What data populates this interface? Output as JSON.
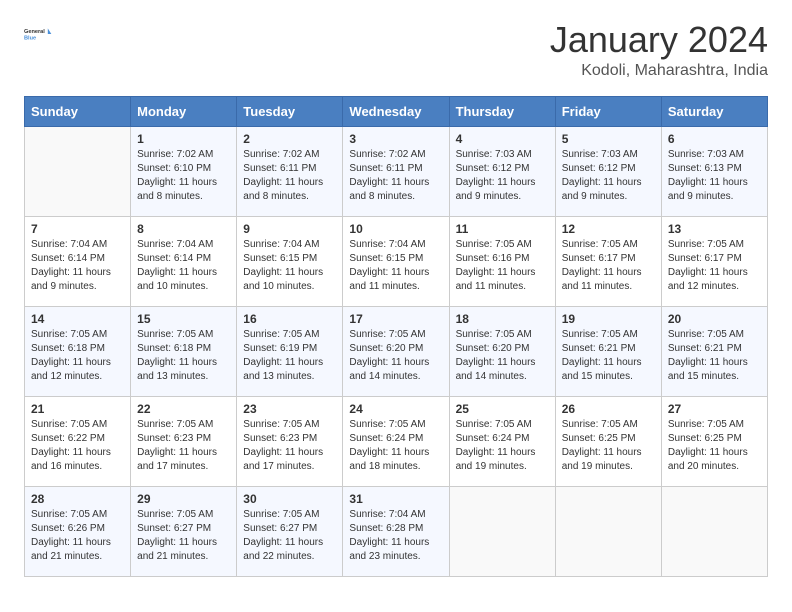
{
  "header": {
    "logo_line1": "General",
    "logo_line2": "Blue",
    "month": "January 2024",
    "location": "Kodoli, Maharashtra, India"
  },
  "weekdays": [
    "Sunday",
    "Monday",
    "Tuesday",
    "Wednesday",
    "Thursday",
    "Friday",
    "Saturday"
  ],
  "weeks": [
    [
      {
        "day": "",
        "info": ""
      },
      {
        "day": "1",
        "info": "Sunrise: 7:02 AM\nSunset: 6:10 PM\nDaylight: 11 hours\nand 8 minutes."
      },
      {
        "day": "2",
        "info": "Sunrise: 7:02 AM\nSunset: 6:11 PM\nDaylight: 11 hours\nand 8 minutes."
      },
      {
        "day": "3",
        "info": "Sunrise: 7:02 AM\nSunset: 6:11 PM\nDaylight: 11 hours\nand 8 minutes."
      },
      {
        "day": "4",
        "info": "Sunrise: 7:03 AM\nSunset: 6:12 PM\nDaylight: 11 hours\nand 9 minutes."
      },
      {
        "day": "5",
        "info": "Sunrise: 7:03 AM\nSunset: 6:12 PM\nDaylight: 11 hours\nand 9 minutes."
      },
      {
        "day": "6",
        "info": "Sunrise: 7:03 AM\nSunset: 6:13 PM\nDaylight: 11 hours\nand 9 minutes."
      }
    ],
    [
      {
        "day": "7",
        "info": "Sunrise: 7:04 AM\nSunset: 6:14 PM\nDaylight: 11 hours\nand 9 minutes."
      },
      {
        "day": "8",
        "info": "Sunrise: 7:04 AM\nSunset: 6:14 PM\nDaylight: 11 hours\nand 10 minutes."
      },
      {
        "day": "9",
        "info": "Sunrise: 7:04 AM\nSunset: 6:15 PM\nDaylight: 11 hours\nand 10 minutes."
      },
      {
        "day": "10",
        "info": "Sunrise: 7:04 AM\nSunset: 6:15 PM\nDaylight: 11 hours\nand 11 minutes."
      },
      {
        "day": "11",
        "info": "Sunrise: 7:05 AM\nSunset: 6:16 PM\nDaylight: 11 hours\nand 11 minutes."
      },
      {
        "day": "12",
        "info": "Sunrise: 7:05 AM\nSunset: 6:17 PM\nDaylight: 11 hours\nand 11 minutes."
      },
      {
        "day": "13",
        "info": "Sunrise: 7:05 AM\nSunset: 6:17 PM\nDaylight: 11 hours\nand 12 minutes."
      }
    ],
    [
      {
        "day": "14",
        "info": "Sunrise: 7:05 AM\nSunset: 6:18 PM\nDaylight: 11 hours\nand 12 minutes."
      },
      {
        "day": "15",
        "info": "Sunrise: 7:05 AM\nSunset: 6:18 PM\nDaylight: 11 hours\nand 13 minutes."
      },
      {
        "day": "16",
        "info": "Sunrise: 7:05 AM\nSunset: 6:19 PM\nDaylight: 11 hours\nand 13 minutes."
      },
      {
        "day": "17",
        "info": "Sunrise: 7:05 AM\nSunset: 6:20 PM\nDaylight: 11 hours\nand 14 minutes."
      },
      {
        "day": "18",
        "info": "Sunrise: 7:05 AM\nSunset: 6:20 PM\nDaylight: 11 hours\nand 14 minutes."
      },
      {
        "day": "19",
        "info": "Sunrise: 7:05 AM\nSunset: 6:21 PM\nDaylight: 11 hours\nand 15 minutes."
      },
      {
        "day": "20",
        "info": "Sunrise: 7:05 AM\nSunset: 6:21 PM\nDaylight: 11 hours\nand 15 minutes."
      }
    ],
    [
      {
        "day": "21",
        "info": "Sunrise: 7:05 AM\nSunset: 6:22 PM\nDaylight: 11 hours\nand 16 minutes."
      },
      {
        "day": "22",
        "info": "Sunrise: 7:05 AM\nSunset: 6:23 PM\nDaylight: 11 hours\nand 17 minutes."
      },
      {
        "day": "23",
        "info": "Sunrise: 7:05 AM\nSunset: 6:23 PM\nDaylight: 11 hours\nand 17 minutes."
      },
      {
        "day": "24",
        "info": "Sunrise: 7:05 AM\nSunset: 6:24 PM\nDaylight: 11 hours\nand 18 minutes."
      },
      {
        "day": "25",
        "info": "Sunrise: 7:05 AM\nSunset: 6:24 PM\nDaylight: 11 hours\nand 19 minutes."
      },
      {
        "day": "26",
        "info": "Sunrise: 7:05 AM\nSunset: 6:25 PM\nDaylight: 11 hours\nand 19 minutes."
      },
      {
        "day": "27",
        "info": "Sunrise: 7:05 AM\nSunset: 6:25 PM\nDaylight: 11 hours\nand 20 minutes."
      }
    ],
    [
      {
        "day": "28",
        "info": "Sunrise: 7:05 AM\nSunset: 6:26 PM\nDaylight: 11 hours\nand 21 minutes."
      },
      {
        "day": "29",
        "info": "Sunrise: 7:05 AM\nSunset: 6:27 PM\nDaylight: 11 hours\nand 21 minutes."
      },
      {
        "day": "30",
        "info": "Sunrise: 7:05 AM\nSunset: 6:27 PM\nDaylight: 11 hours\nand 22 minutes."
      },
      {
        "day": "31",
        "info": "Sunrise: 7:04 AM\nSunset: 6:28 PM\nDaylight: 11 hours\nand 23 minutes."
      },
      {
        "day": "",
        "info": ""
      },
      {
        "day": "",
        "info": ""
      },
      {
        "day": "",
        "info": ""
      }
    ]
  ]
}
